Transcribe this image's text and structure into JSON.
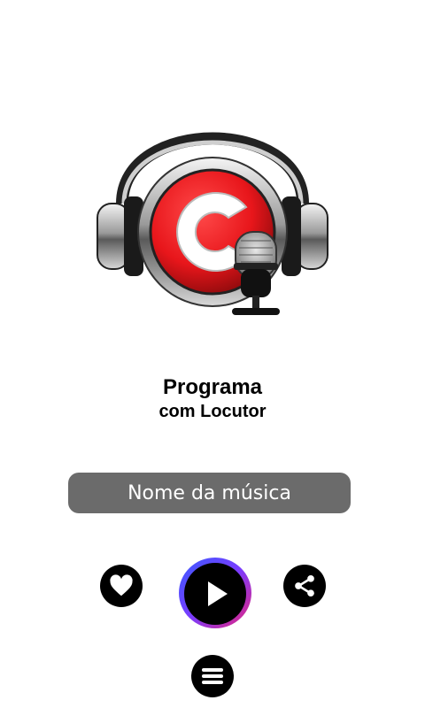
{
  "logo": {
    "letter": "C",
    "description_icon": "radio-headphones-microphone-logo"
  },
  "program": {
    "title": "Programa",
    "subtitle": "com Locutor"
  },
  "song": {
    "name": "Nome da música"
  },
  "controls": {
    "like_icon": "heart-icon",
    "play_icon": "play-icon",
    "share_icon": "share-icon",
    "menu_icon": "menu-icon"
  },
  "colors": {
    "song_bar": "#6b6b6b",
    "logo_red": "#e8161b",
    "play_gradient_start": "#3a5bff",
    "play_gradient_end": "#e8237a"
  }
}
